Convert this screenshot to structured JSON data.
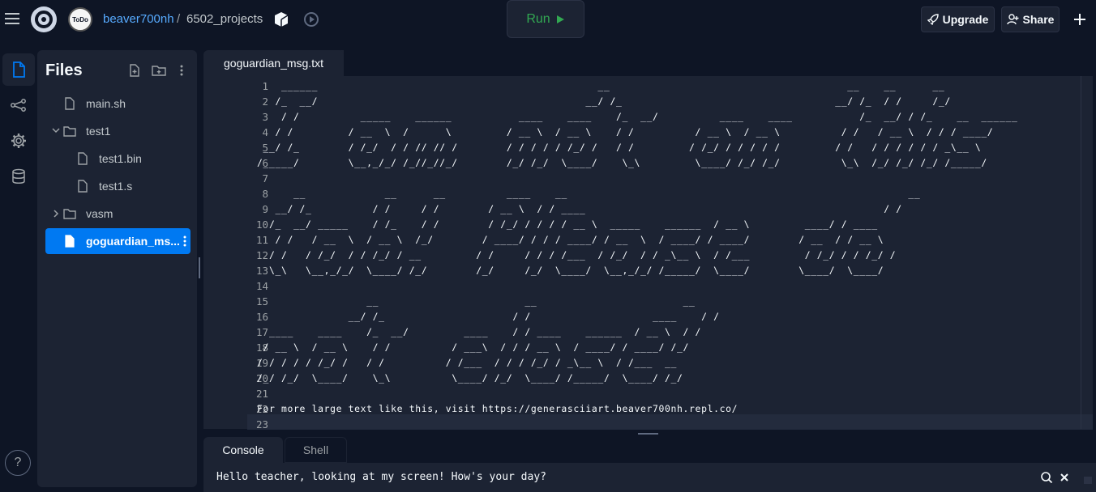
{
  "header": {
    "avatar_text": "ToDo",
    "username": "beaver700nh",
    "separator": "/",
    "project": "6502_projects",
    "run_label": "Run",
    "upgrade_label": "Upgrade",
    "share_label": "Share"
  },
  "sidebar": {
    "title": "Files",
    "items": [
      {
        "label": "main.sh"
      },
      {
        "label": "test1"
      },
      {
        "label": "test1.bin"
      },
      {
        "label": "test1.s"
      },
      {
        "label": "vasm"
      },
      {
        "label": "goguardian_ms..."
      }
    ],
    "help_label": "?"
  },
  "editor": {
    "tab_label": "goguardian_msg.txt",
    "line_numbers": [
      "1",
      "2",
      "3",
      "4",
      "5",
      "6",
      "7",
      "8",
      "9",
      "10",
      "11",
      "12",
      "13",
      "14",
      "15",
      "16",
      "17",
      "18",
      "19",
      "20",
      "21",
      "22",
      "23"
    ],
    "lines": [
      "    ______                                              __                                       __    __      __",
      "   /_  __/                                            __/ /_                                   __/ /_  / /     /_/",
      "    / /          _____    ______           ____    ____    /_  __/          ____    ____           /_  __/ / /_    __  ______",
      "   / /         / __  \\  /      \\         / __ \\  / __ \\    / /          / __ \\  / __ \\          / /   / __ \\  / / / ____/",
      " __/ /_        / /_/  / / // // /        / / / / / /_/ /   / /         / /_/ / / / / /         / /   / / / / / / _\\__ \\",
      "/_____/        \\__,_/_/ /_//_//_/        /_/ /_/  \\____/    \\_\\         \\____/ /_/ /_/          \\_\\  /_/ /_/ /_/ /_____/",
      "",
      "      __             __      __          ____    __                                                        __",
      "   __/ /_          / /     / /        / __ \\  / / ____                                                 / /",
      "  /_  __/ _____    / /_    / /        / /_/ / / / / __ \\  _____    ______  / __ \\         ____/ / ____",
      "   / /   / __  \\  / __ \\  /_/        / ____/ / / / ____/ / __  \\  / ____/ / ____/        / __  / / __ \\",
      "  / /   / /_/  / / /_/ / __         / /     / / / /___  / /_/  / / _\\__ \\  / /___         / /_/ / / /_/ /",
      "  \\_\\   \\__,_/_/  \\____/ /_/        /_/     /_/  \\____/  \\__,_/_/ /_____/  \\____/        \\____/  \\____/",
      "",
      "                  __                        __                        __",
      "               __/ /_                     / /                    ____    / /",
      "  ____    ____    /_  __/         ____    / / ____    ______  / __ \\  / /",
      " / __ \\  / __ \\    / /          / ___\\  / / / __ \\  / ____/ / ____/ /_/",
      "/ / / / / /_/ /   / /          / /___  / / / /_/ / _\\__ \\  / /___  __",
      "/_/ /_/  \\____/    \\_\\          \\____/ /_/  \\____/ /_____/  \\____/ /_/",
      "",
      "For more large text like this, visit https://generasciiart.beaver700nh.repl.co/",
      ""
    ]
  },
  "console": {
    "tabs": [
      "Console",
      "Shell"
    ],
    "output": "Hello teacher, looking at my screen! How's your day?"
  },
  "colors": {
    "background": "#0e1525",
    "panel": "#1c2333",
    "accent": "#0079f2",
    "link": "#57abff",
    "run_green": "#32a852"
  }
}
